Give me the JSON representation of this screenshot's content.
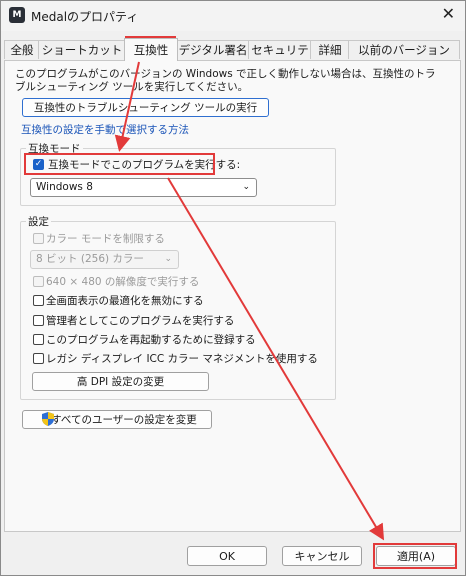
{
  "window": {
    "title": "Medalのプロパティ",
    "app_icon_text": "M"
  },
  "tabs": [
    "全般",
    "ショートカット",
    "互換性",
    "デジタル署名",
    "セキュリティ",
    "詳細",
    "以前のバージョン"
  ],
  "description": "このプログラムがこのバージョンの Windows で正しく動作しない場合は、互換性のトラブルシューティング ツールを実行してください。",
  "troubleshoot_button": "互換性のトラブルシューティング ツールの実行",
  "manual_link": "互換性の設定を手動で選択する方法",
  "compat_mode": {
    "group_label": "互換モード",
    "checkbox_label": "互換モードでこのプログラムを実行する:",
    "selected_os": "Windows 8"
  },
  "settings": {
    "group_label": "設定",
    "reduced_color": "カラー モードを制限する",
    "color_select": "8 ビット (256) カラー",
    "res_640": "640 × 480 の解像度で実行する",
    "fullscreen_opt": "全画面表示の最適化を無効にする",
    "run_admin": "管理者としてこのプログラムを実行する",
    "register_restart": "このプログラムを再起動するために登録する",
    "legacy_icc": "レガシ ディスプレイ ICC カラー マネジメントを使用する",
    "high_dpi_button": "高 DPI 設定の変更"
  },
  "all_users_button": "すべてのユーザーの設定を変更",
  "footer": {
    "ok": "OK",
    "cancel": "キャンセル",
    "apply": "適用(A)"
  },
  "colors": {
    "highlight": "#e23a3a",
    "check": "#1b62c9",
    "link": "#1b55b8"
  }
}
